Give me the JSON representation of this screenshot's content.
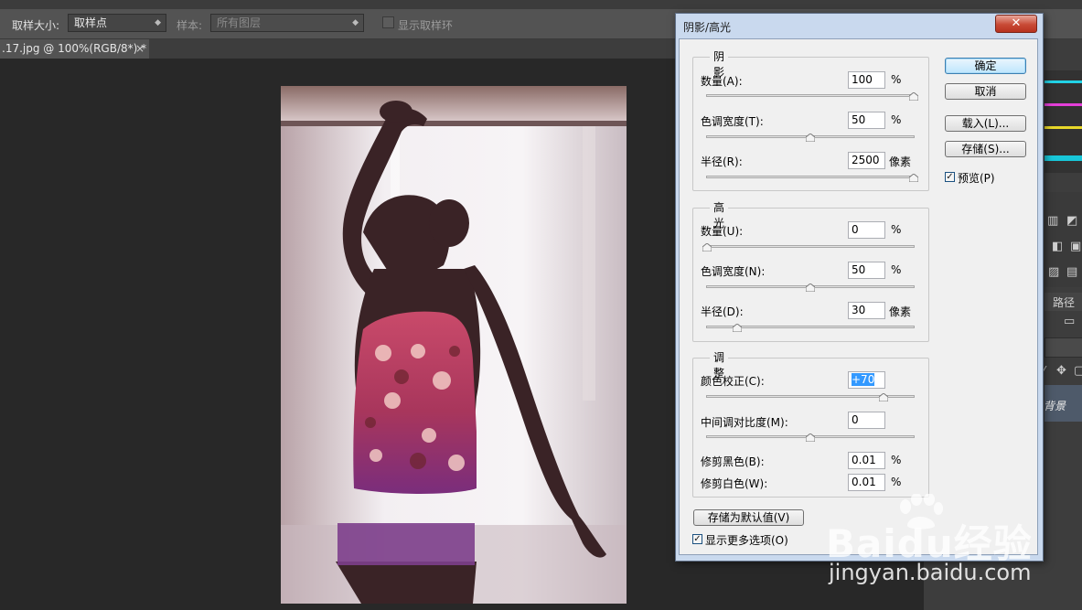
{
  "options_bar": {
    "sample_size_label": "取样大小:",
    "sample_size_value": "取样点",
    "sample_label": "样本:",
    "sample_value": "所有图层",
    "show_sampling_ring": "显示取样环"
  },
  "document_tab": {
    "title": ".17.jpg @ 100%(RGB/8*) *",
    "close": "×"
  },
  "right_panel": {
    "paths_tab": "路径",
    "layer_name": "背景"
  },
  "dialog": {
    "title": "阴影/高光",
    "close": "✕",
    "shadows": {
      "group_title": "阴影",
      "amount_label": "数量(A):",
      "amount_value": "100",
      "amount_unit": "%",
      "amount_level": 1.0,
      "tonal_width_label": "色调宽度(T):",
      "tonal_width_value": "50",
      "tonal_width_unit": "%",
      "tonal_width_level": 0.5,
      "radius_label": "半径(R):",
      "radius_value": "2500",
      "radius_unit": "像素",
      "radius_level": 1.0
    },
    "highlights": {
      "group_title": "高光",
      "amount_label": "数量(U):",
      "amount_value": "0",
      "amount_unit": "%",
      "amount_level": 0.0,
      "tonal_width_label": "色调宽度(N):",
      "tonal_width_value": "50",
      "tonal_width_unit": "%",
      "tonal_width_level": 0.5,
      "radius_label": "半径(D):",
      "radius_value": "30",
      "radius_unit": "像素",
      "radius_level": 0.15
    },
    "adjustments": {
      "group_title": "调整",
      "color_correction_label": "颜色校正(C):",
      "color_correction_value": "+70",
      "color_correction_level": 0.85,
      "midtone_contrast_label": "中间调对比度(M):",
      "midtone_contrast_value": "0",
      "midtone_contrast_level": 0.5,
      "black_clip_label": "修剪黑色(B):",
      "black_clip_value": "0.01",
      "black_clip_unit": "%",
      "white_clip_label": "修剪白色(W):",
      "white_clip_value": "0.01",
      "white_clip_unit": "%"
    },
    "buttons": {
      "ok": "确定",
      "cancel": "取消",
      "load": "载入(L)...",
      "save": "存储(S)...",
      "save_default": "存储为默认值(V)"
    },
    "preview_label": "预览(P)",
    "preview_checked": true,
    "more_options_label": "显示更多选项(O)",
    "more_options_checked": true
  },
  "watermark": {
    "brand": "Baidu经验",
    "url": "jingyan.baidu.com"
  }
}
